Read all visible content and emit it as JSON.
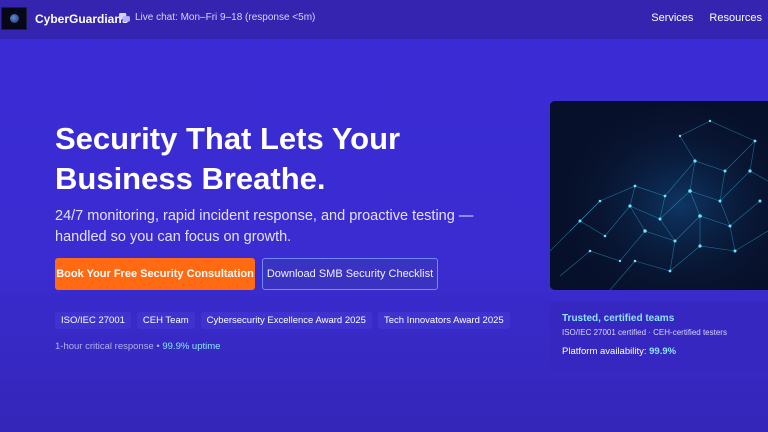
{
  "header": {
    "brand": "CyberGuardians",
    "logo_icon": "globe-logo-icon",
    "chat_icon": "chat-bubbles-icon",
    "chat_text": "Live chat: Mon–Fri 9–18 (response <5m)",
    "nav": [
      "Services",
      "Resources"
    ]
  },
  "hero": {
    "title": "Security That Lets Your Business Breathe.",
    "subtitle": "24/7 monitoring, rapid incident response, and proactive testing — handled so you can focus on growth.",
    "primary_cta": "Book Your Free Security Consultation",
    "secondary_cta": "Download SMB Security Checklist",
    "badges": [
      "ISO/IEC 27001",
      "CEH Team",
      "Cybersecurity Excellence Award 2025",
      "Tech Innovators Award 2025"
    ],
    "response_text": "1-hour critical response",
    "separator": " • ",
    "uptime_text": "99.9% uptime"
  },
  "trust": {
    "title": "Trusted, certified teams",
    "certs": "ISO/IEC 27001 certified · CEH-certified testers",
    "availability_label": "Platform availability: ",
    "availability_value": "99.9%"
  },
  "colors": {
    "background": "#3b2bd6",
    "header": "#3424b0",
    "primary_cta": "#ff6a13",
    "accent": "#8fe3ff",
    "secondary_border": "#6e8bff"
  }
}
